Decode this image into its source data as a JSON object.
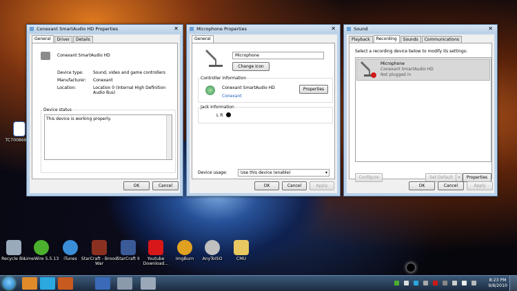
{
  "desktop": {
    "file_icon_label": "TC7008680...",
    "icons": [
      {
        "label": "Recycle Bin",
        "color": "#9ab"
      },
      {
        "label": "LimeWire 5.5.13",
        "color": "#4caf2e"
      },
      {
        "label": "iTunes",
        "color": "#3a8ed8"
      },
      {
        "label": "StarCraft - Brood War",
        "color": "#8a3020"
      },
      {
        "label": "StarCraft II",
        "color": "#3a5a98"
      },
      {
        "label": "Youtube Download...",
        "color": "#d81818"
      },
      {
        "label": "ImgBurn",
        "color": "#e0a020"
      },
      {
        "label": "AnyToISO",
        "color": "#c0c0c0"
      },
      {
        "label": "CMU",
        "color": "#e8c860"
      }
    ]
  },
  "device_props": {
    "title": "Conexant SmartAudio HD Properties",
    "tabs": [
      "General",
      "Driver",
      "Details"
    ],
    "device_name": "Conexant SmartAudio HD",
    "rows": [
      {
        "label": "Device type:",
        "value": "Sound, video and game controllers"
      },
      {
        "label": "Manufacturer:",
        "value": "Conexant"
      },
      {
        "label": "Location:",
        "value": "Location 0 (Internal High Definition Audio Bus)"
      }
    ],
    "status_group": "Device status",
    "status_text": "This device is working properly.",
    "ok": "OK",
    "cancel": "Cancel"
  },
  "mic_props": {
    "title": "Microphone Properties",
    "tabs": [
      "General"
    ],
    "name_value": "Microphone",
    "change_icon": "Change Icon",
    "controller_group": "Controller Information",
    "controller_name": "Conexant SmartAudio HD",
    "controller_link": "Conexant",
    "properties": "Properties",
    "jack_group": "Jack Information",
    "jack_text": "L R",
    "usage_label": "Device usage:",
    "usage_value": "Use this device (enable)",
    "ok": "OK",
    "cancel": "Cancel",
    "apply": "Apply"
  },
  "sound": {
    "title": "Sound",
    "tabs": [
      "Playback",
      "Recording",
      "Sounds",
      "Communications"
    ],
    "instruction": "Select a recording device below to modify its settings:",
    "device": {
      "name": "Microphone",
      "driver": "Conexant SmartAudio HD",
      "status": "Not plugged in"
    },
    "configure": "Configure",
    "set_default": "Set Default",
    "properties": "Properties",
    "ok": "OK",
    "cancel": "Cancel",
    "apply": "Apply"
  },
  "taskbar": {
    "time": "8:23 PM",
    "date": "9/8/2010",
    "pinned": [
      "windows-explorer",
      "firefox",
      "skype",
      "media-player",
      "word",
      "device-manager",
      "audio-app"
    ]
  },
  "colors": {
    "accent_link": "#1e5cb8",
    "error_red": "#d01818"
  }
}
